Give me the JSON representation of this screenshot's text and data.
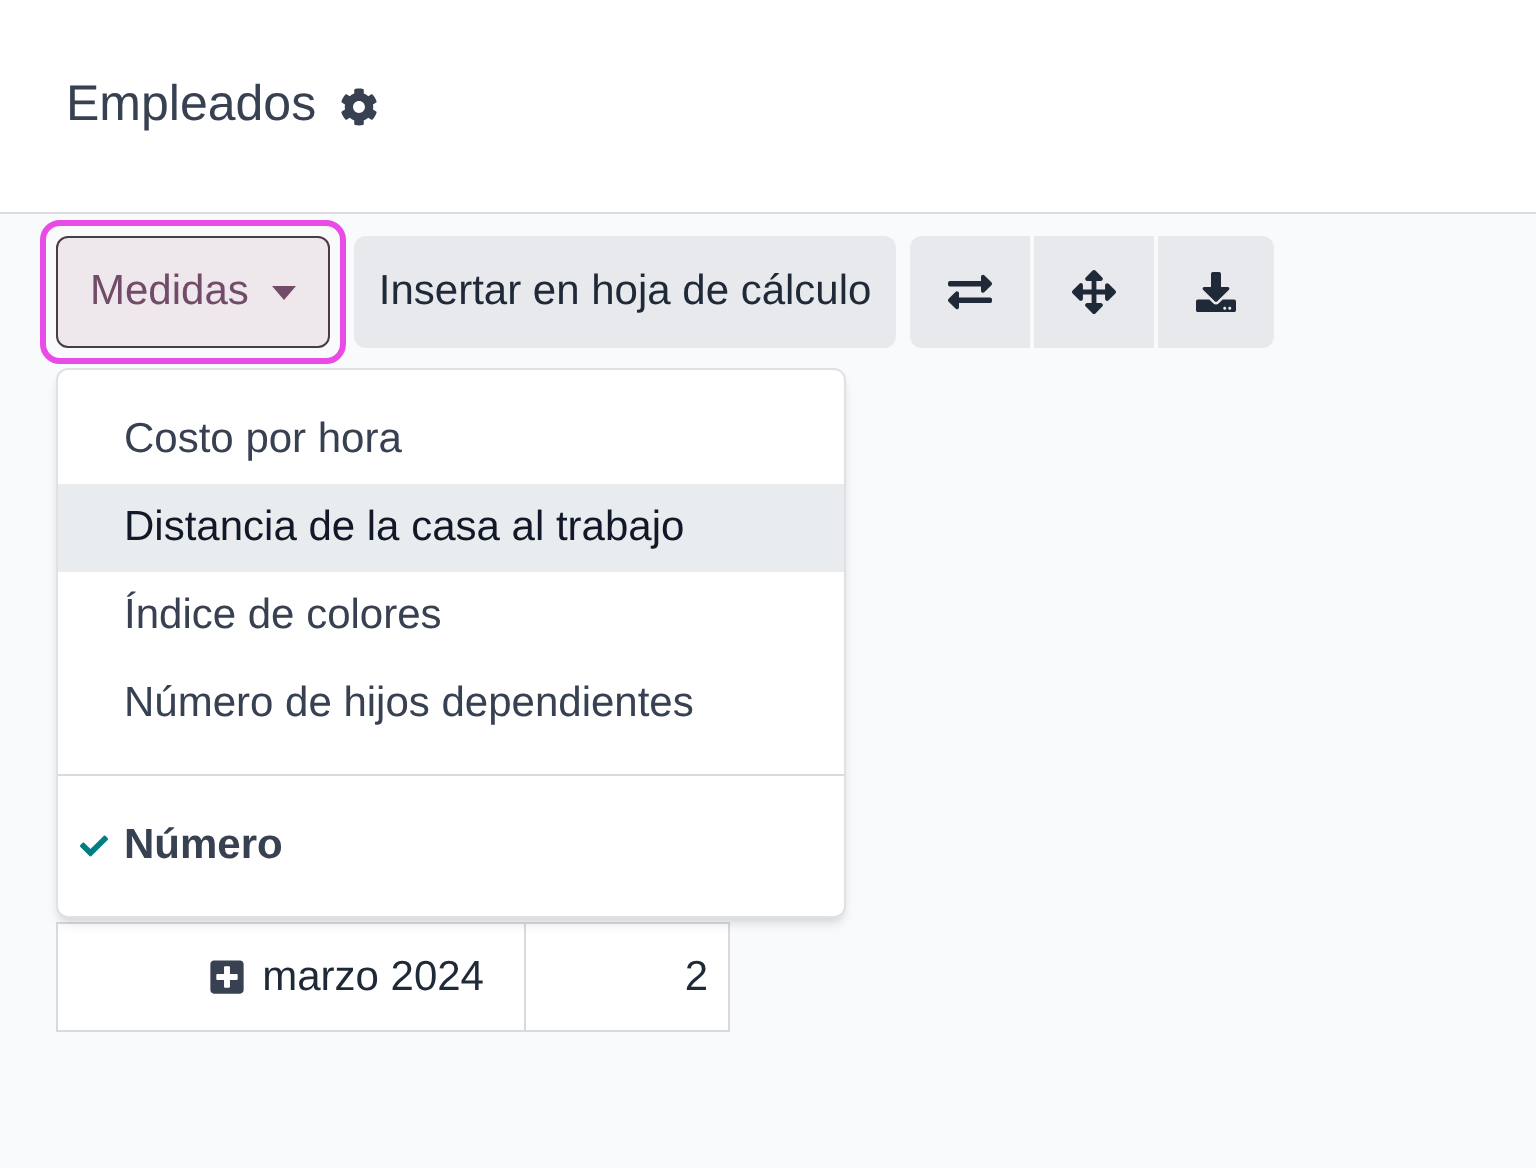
{
  "header": {
    "title": "Empleados"
  },
  "toolbar": {
    "measures_button": {
      "label": "Medidas",
      "highlighted": true
    },
    "insert_button": {
      "label": "Insertar en hoja de cálculo"
    }
  },
  "measures_menu": {
    "sections": [
      {
        "items": [
          {
            "label": "Costo por hora",
            "checked": false,
            "hovered": false
          },
          {
            "label": "Distancia de la casa al trabajo",
            "checked": false,
            "hovered": true
          },
          {
            "label": "Índice de colores",
            "checked": false,
            "hovered": false
          },
          {
            "label": "Número de hijos dependientes",
            "checked": false,
            "hovered": false
          }
        ]
      },
      {
        "items": [
          {
            "label": "Número",
            "checked": true,
            "hovered": false
          }
        ]
      }
    ]
  },
  "table": {
    "rows": [
      {
        "header": "marzo 2024",
        "value": "2",
        "expanded": false
      }
    ]
  }
}
